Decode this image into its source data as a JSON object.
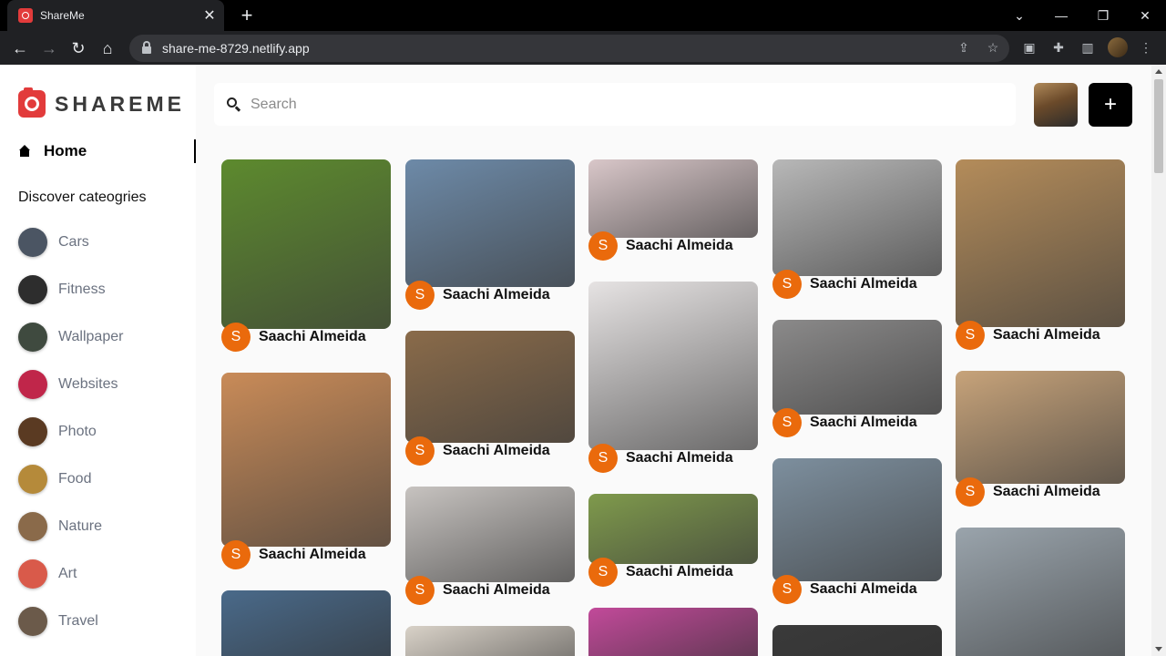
{
  "browser": {
    "tab_title": "ShareMe",
    "url": "share-me-8729.netlify.app"
  },
  "app": {
    "logo_text": "SHAREME",
    "home_label": "Home",
    "discover_label": "Discover cateogries",
    "search_placeholder": "Search",
    "add_label": "+"
  },
  "categories": [
    {
      "label": "Cars",
      "color": "#4b5563"
    },
    {
      "label": "Fitness",
      "color": "#2d2d2d"
    },
    {
      "label": "Wallpaper",
      "color": "#3f4a3f"
    },
    {
      "label": "Websites",
      "color": "#c0264a"
    },
    {
      "label": "Photo",
      "color": "#5a3a22"
    },
    {
      "label": "Food",
      "color": "#b58a3a"
    },
    {
      "label": "Nature",
      "color": "#8a6a4a"
    },
    {
      "label": "Art",
      "color": "#d95a4a"
    },
    {
      "label": "Travel",
      "color": "#6b5a4a"
    }
  ],
  "pins": [
    {
      "author": "Saachi Almeida",
      "initial": "S",
      "img_color": "#5d8a2e"
    },
    {
      "author": "Saachi Almeida",
      "initial": "S",
      "img_color": "#c98b58"
    },
    {
      "author": "Saachi Almeida",
      "initial": "S",
      "img_color": "#6d8aa8"
    },
    {
      "author": "Saachi Almeida",
      "initial": "S",
      "img_color": "#8a6b4a"
    },
    {
      "author": "Saachi Almeida",
      "initial": "S",
      "img_color": "#c7c3c0"
    },
    {
      "author": "Saachi Almeida",
      "initial": "S",
      "img_color": "#d9c7c9"
    },
    {
      "author": "Saachi Almeida",
      "initial": "S",
      "img_color": "#e6e3e3"
    },
    {
      "author": "Saachi Almeida",
      "initial": "S",
      "img_color": "#7f9a4c"
    },
    {
      "author": "Saachi Almeida",
      "initial": "S",
      "img_color": "#b8b8b8"
    },
    {
      "author": "Saachi Almeida",
      "initial": "S",
      "img_color": "#8b8a8a"
    },
    {
      "author": "Saachi Almeida",
      "initial": "S",
      "img_color": "#7d8f9e"
    },
    {
      "author": "Saachi Almeida",
      "initial": "S",
      "img_color": "#b48c5a"
    },
    {
      "author": "Saachi Almeida",
      "initial": "S",
      "img_color": "#c7a37a"
    }
  ]
}
